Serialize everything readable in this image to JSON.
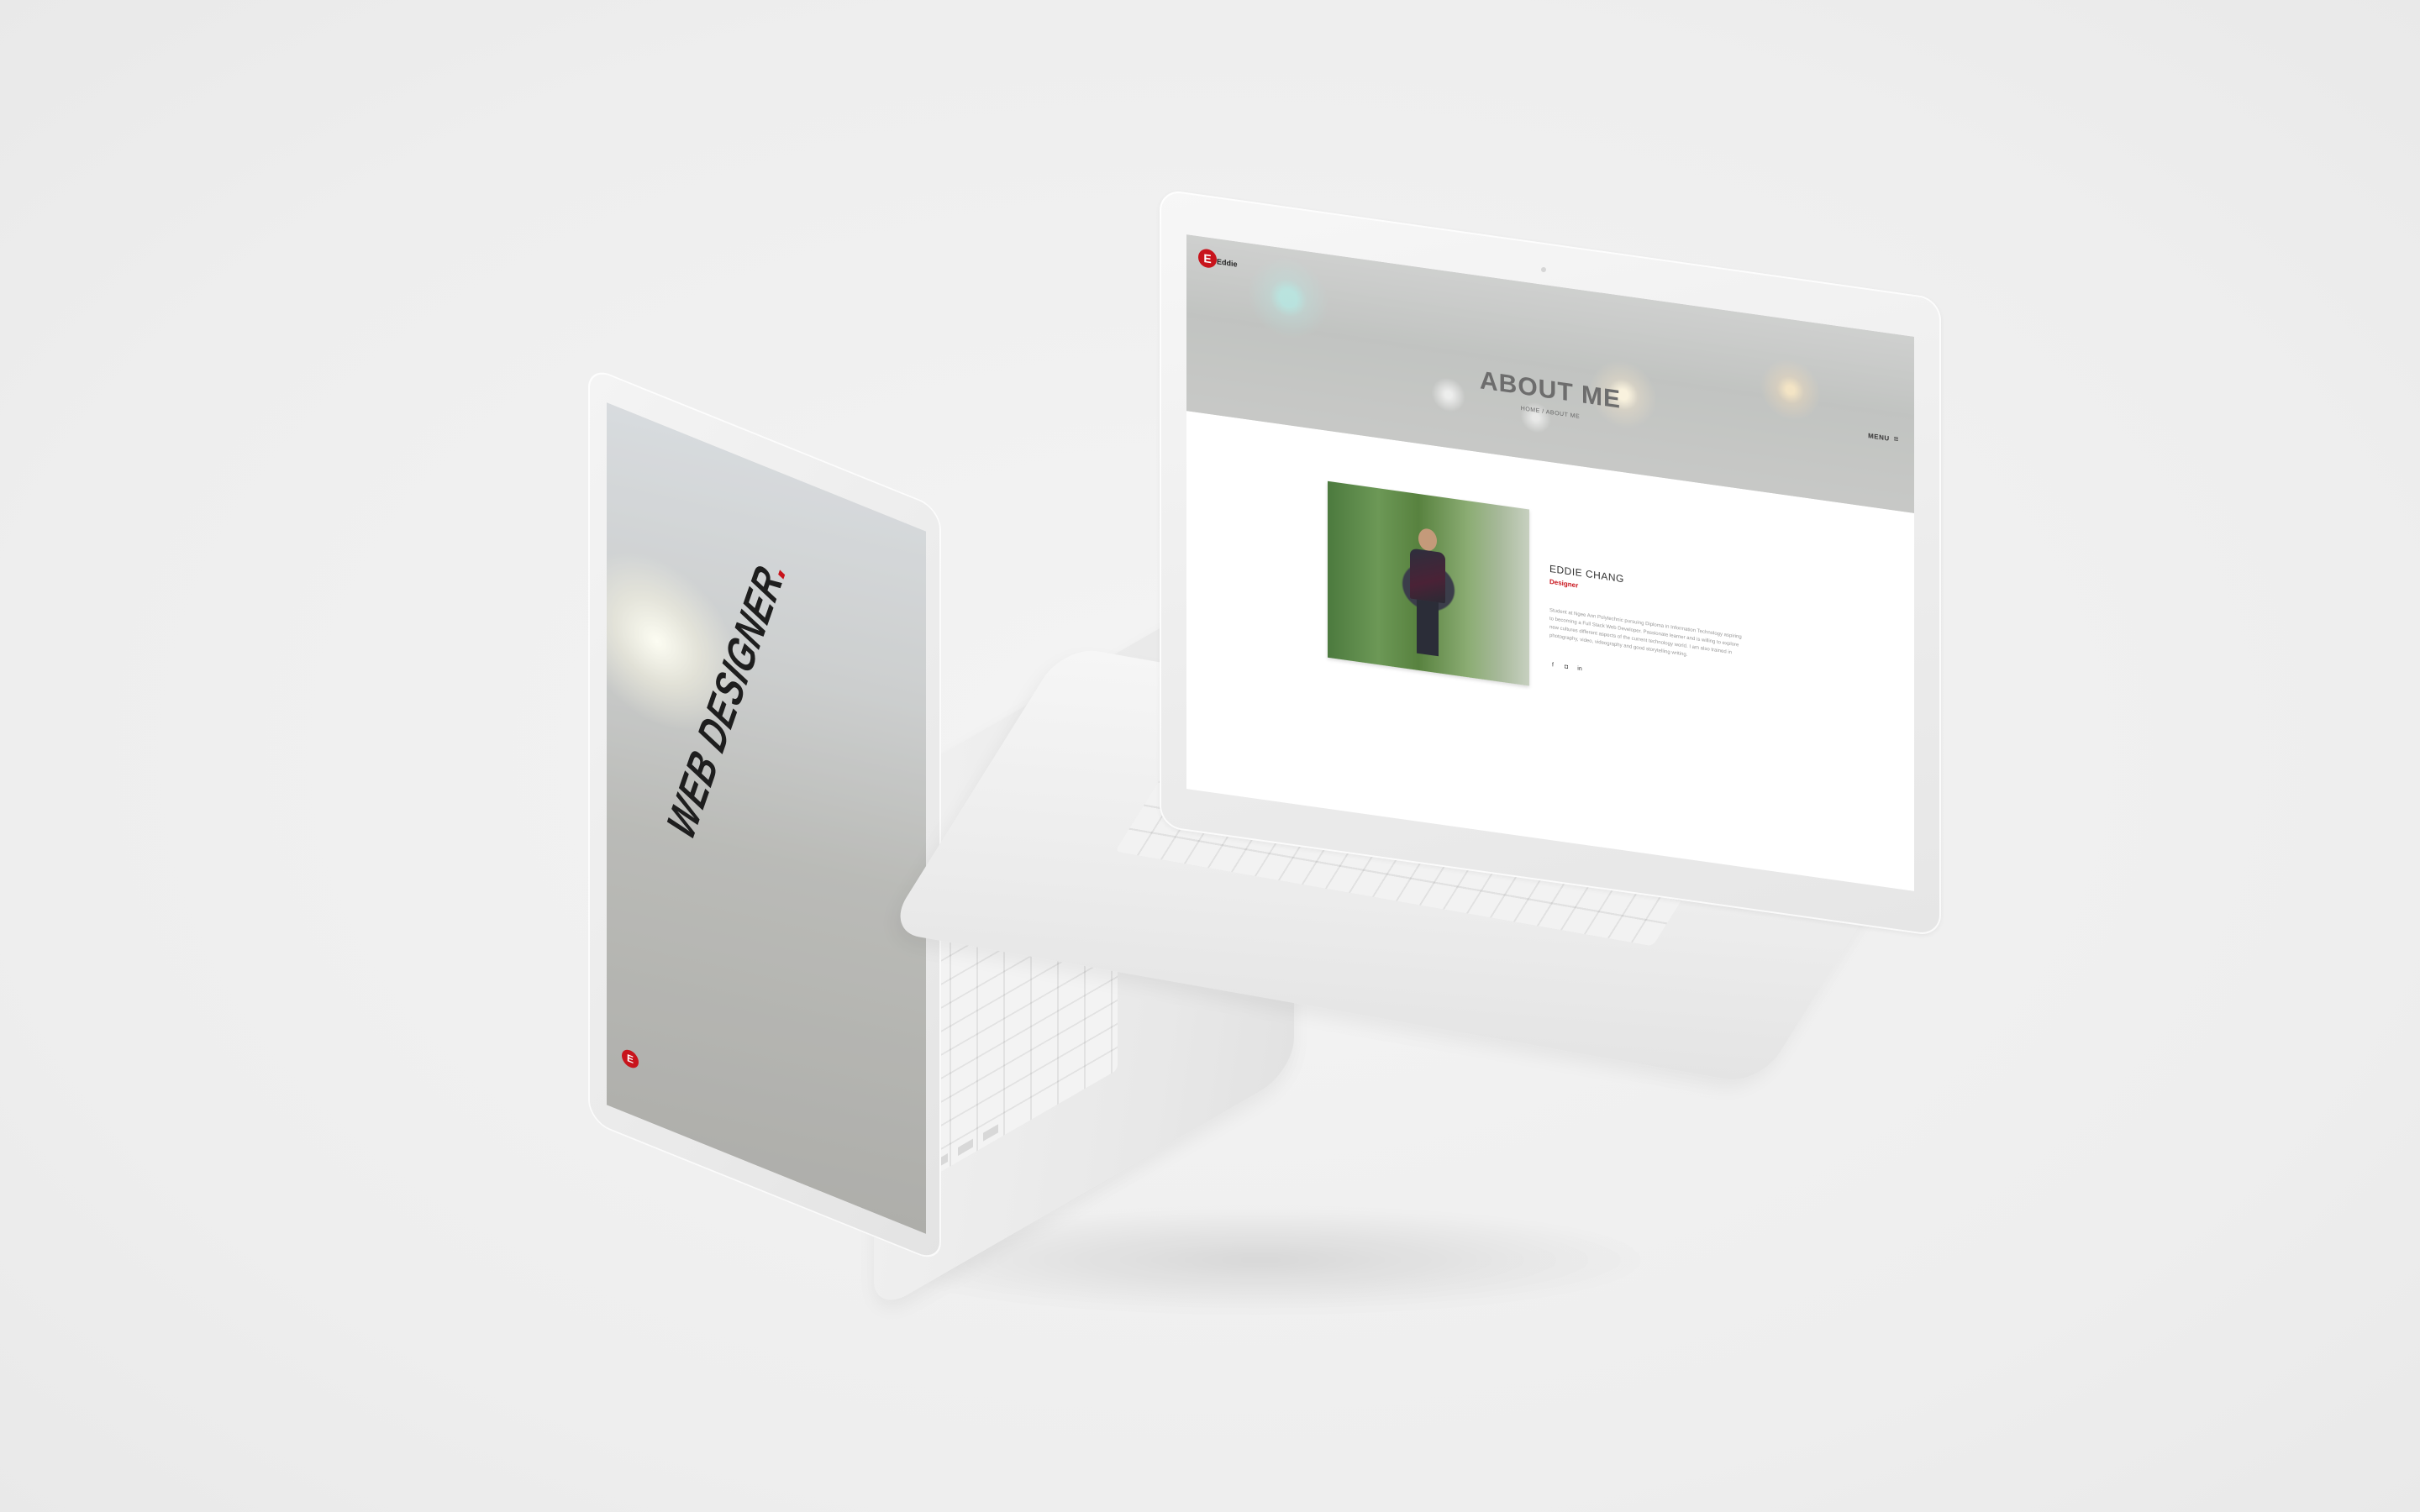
{
  "right_laptop": {
    "logo_letter": "E",
    "logo_word": "Eddie",
    "menu_label": "MENU",
    "menu_icon": "hamburger-icon",
    "hero_title": "ABOUT ME",
    "breadcrumb": "HOME / ABOUT ME",
    "profile_name": "EDDIE CHANG",
    "profile_role": "Designer",
    "profile_bio": "Student at Ngee Ann Polytechnic pursuing Diploma in Information Technology aspiring to becoming a Full Stack Web Developer. Passionate learner and is willing to explore new cultures different aspects of the current technology world. I am also trained in photography, video, videography and good storytelling writing.",
    "social_icons": [
      "facebook-icon",
      "instagram-icon",
      "linkedin-icon"
    ],
    "social_glyphs": [
      "f",
      "◘",
      "in"
    ]
  },
  "left_laptop": {
    "headline": "WEB DESIGNER",
    "headline_dot": ".",
    "logo_letter": "E"
  },
  "colors": {
    "brand_red": "#c8141c",
    "background": "#f0f0f0"
  }
}
